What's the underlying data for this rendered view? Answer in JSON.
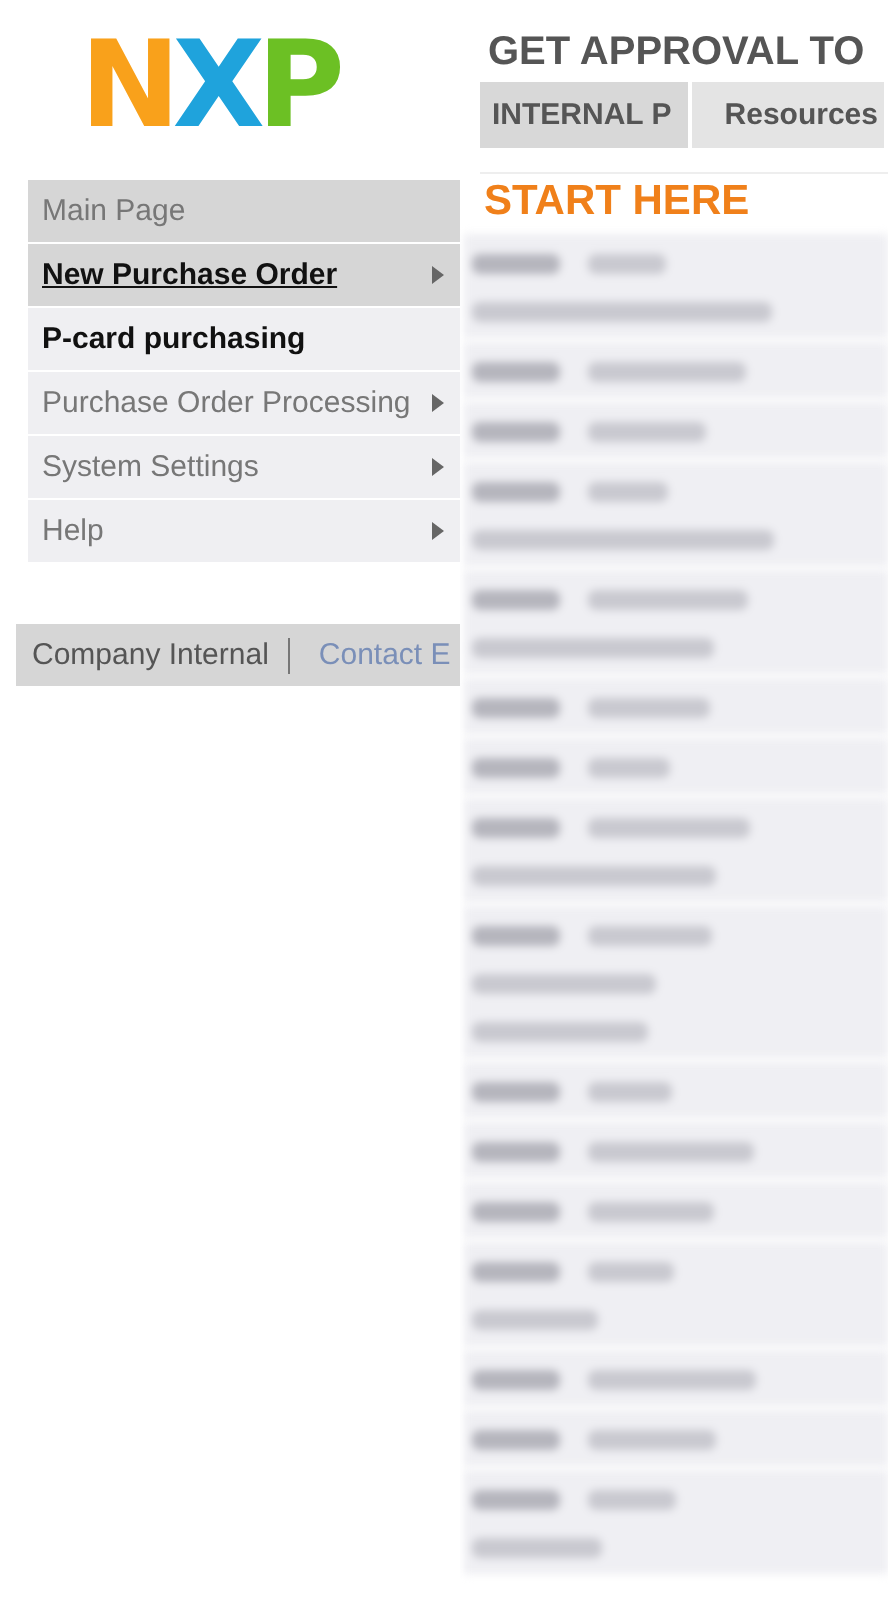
{
  "logo": {
    "letters": [
      {
        "text": "N",
        "color": "#f9a11b"
      },
      {
        "text": "X",
        "color": "#1fa3dc"
      },
      {
        "text": "P",
        "color": "#6cc024"
      }
    ]
  },
  "page_title": "GET APPROVAL TO",
  "tabs": [
    {
      "label": "INTERNAL P",
      "selected": true
    },
    {
      "label": "Resources",
      "selected": false
    }
  ],
  "menu": [
    {
      "label": "Main Page",
      "kind": "heading",
      "selected": false,
      "has_submenu": false
    },
    {
      "label": "New Purchase Order",
      "kind": "bold",
      "selected": true,
      "has_submenu": true
    },
    {
      "label": "P-card purchasing",
      "kind": "bold",
      "selected": false,
      "has_submenu": false
    },
    {
      "label": "Purchase Order Processing",
      "kind": "normal",
      "selected": false,
      "has_submenu": true
    },
    {
      "label": "System Settings",
      "kind": "normal",
      "selected": false,
      "has_submenu": true
    },
    {
      "label": "Help",
      "kind": "normal",
      "selected": false,
      "has_submenu": true
    }
  ],
  "footer": {
    "text": "Company Internal",
    "link": "Contact E"
  },
  "content": {
    "heading": "START HERE",
    "rows": [
      {
        "kind": "double"
      },
      {
        "kind": "single"
      },
      {
        "kind": "single"
      },
      {
        "kind": "double"
      },
      {
        "kind": "double"
      },
      {
        "kind": "single"
      },
      {
        "kind": "single"
      },
      {
        "kind": "double"
      },
      {
        "kind": "triple"
      },
      {
        "kind": "single"
      },
      {
        "kind": "single"
      },
      {
        "kind": "single"
      },
      {
        "kind": "double"
      },
      {
        "kind": "single"
      },
      {
        "kind": "single"
      },
      {
        "kind": "double"
      }
    ]
  }
}
